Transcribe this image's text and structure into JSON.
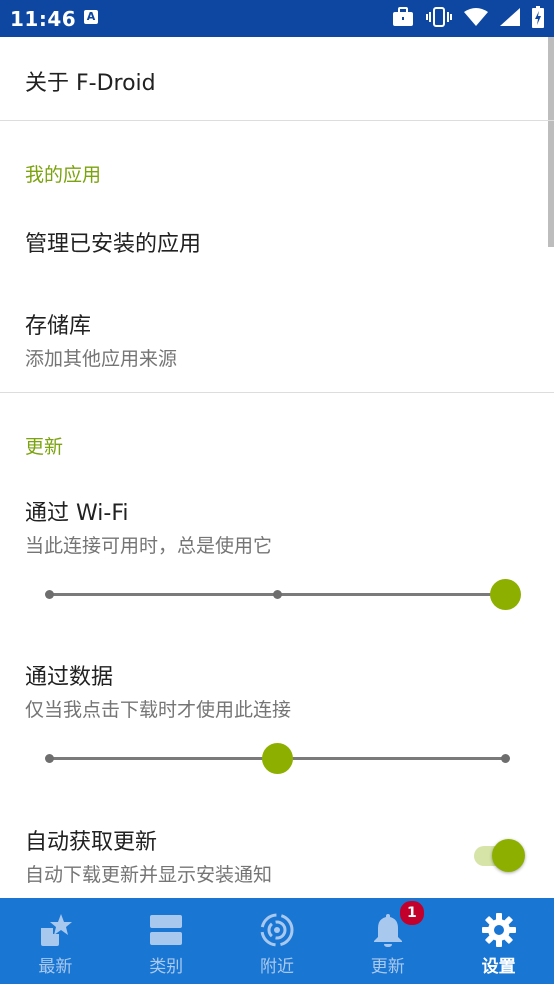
{
  "status_bar": {
    "time": "11:46",
    "notification_glyph": "A"
  },
  "about": {
    "title": "关于 F-Droid"
  },
  "my_apps": {
    "category": "我的应用",
    "manage_installed": {
      "title": "管理已安装的应用"
    },
    "repositories": {
      "title": "存储库",
      "summary": "添加其他应用来源"
    }
  },
  "updates": {
    "category": "更新",
    "over_wifi": {
      "title": "通过 Wi-Fi",
      "summary": "当此连接可用时，总是使用它",
      "slider_steps": 3,
      "slider_value": 2
    },
    "over_data": {
      "title": "通过数据",
      "summary": "仅当我点击下载时才使用此连接",
      "slider_steps": 3,
      "slider_value": 1
    },
    "auto_fetch": {
      "title": "自动获取更新",
      "summary": "自动下载更新并显示安装通知",
      "enabled": true
    }
  },
  "bottom_nav": {
    "items": [
      {
        "label": "最新",
        "icon": "star-apps-icon",
        "active": false
      },
      {
        "label": "类别",
        "icon": "categories-icon",
        "active": false
      },
      {
        "label": "附近",
        "icon": "nearby-icon",
        "active": false
      },
      {
        "label": "更新",
        "icon": "bell-icon",
        "active": false,
        "badge": "1"
      },
      {
        "label": "设置",
        "icon": "gear-icon",
        "active": true
      }
    ]
  },
  "colors": {
    "status_bar": "#0D47A1",
    "bottom_nav": "#1976D2",
    "accent": "#8DB000",
    "category_text": "#7BA30E",
    "badge": "#C2002B"
  }
}
